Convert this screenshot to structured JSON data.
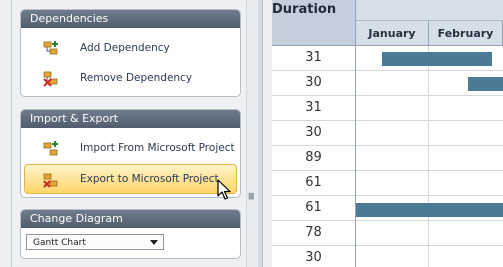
{
  "panel": {
    "dependencies": {
      "title": "Dependencies",
      "items": [
        {
          "label": "Add Dependency",
          "icon": "add-dependency-icon"
        },
        {
          "label": "Remove Dependency",
          "icon": "remove-dependency-icon"
        }
      ]
    },
    "import_export": {
      "title": "Import & Export",
      "items": [
        {
          "label": "Import From Microsoft Project",
          "icon": "import-project-icon"
        },
        {
          "label": "Export to Microsoft Project",
          "icon": "export-project-icon",
          "highlighted": true
        }
      ]
    },
    "change_diagram": {
      "title": "Change Diagram",
      "selected": "Gantt Chart"
    }
  },
  "grid": {
    "duration_header": "Duration",
    "months": [
      "January",
      "February"
    ],
    "durations": [
      "31",
      "30",
      "31",
      "30",
      "89",
      "61",
      "61",
      "78",
      "30"
    ]
  },
  "colors": {
    "task_bar": "#4a7a96",
    "group_header": "#5c6a7a",
    "highlight": "#ffd56a"
  }
}
